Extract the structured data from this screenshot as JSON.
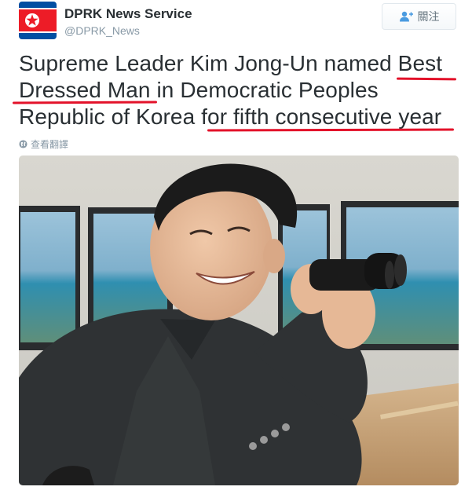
{
  "account": {
    "display_name": "DPRK News Service",
    "handle": "@DPRK_News",
    "avatar": "dprk-flag"
  },
  "follow_button": {
    "label": "關注",
    "icon": "add-user-icon"
  },
  "tweet": {
    "lines": [
      "Supreme Leader Kim Jong-Un named Best",
      "Dressed Man in Democratic Peoples",
      "Republic of Korea for fifth consecutive year"
    ]
  },
  "translate": {
    "label": "查看翻譯",
    "icon": "globe-icon"
  },
  "colors": {
    "underline": "#e3122a",
    "handle": "#8899a6",
    "text": "#292f33"
  }
}
